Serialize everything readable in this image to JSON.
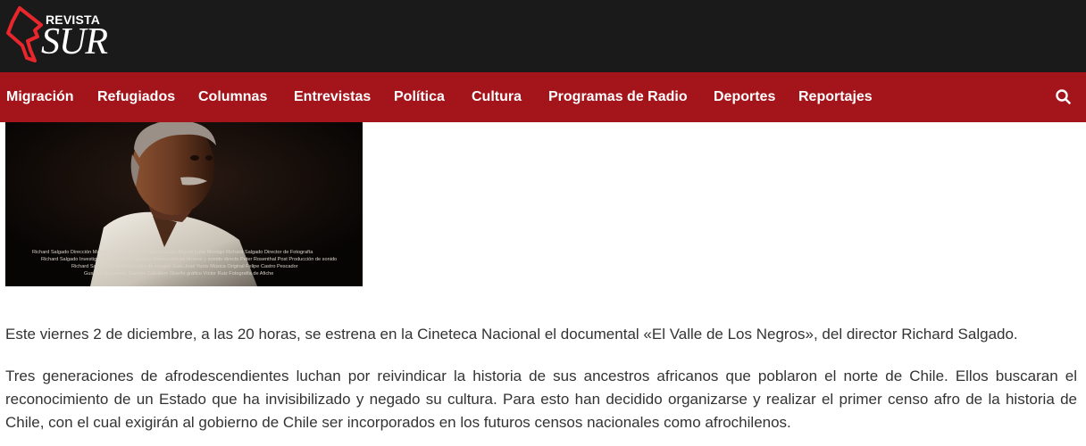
{
  "header": {
    "logo_small": "REVISTA",
    "logo_big": "SUR"
  },
  "nav": {
    "items": [
      {
        "label": "Migración"
      },
      {
        "label": "Refugiados"
      },
      {
        "label": "Columnas"
      },
      {
        "label": "Entrevistas"
      },
      {
        "label": "Política"
      },
      {
        "label": "Cultura"
      },
      {
        "label": "Programas de Radio"
      },
      {
        "label": "Deportes"
      },
      {
        "label": "Reportajes"
      }
    ],
    "search_icon": "search-icon"
  },
  "article": {
    "image_credits": [
      "Richard Salgado Dirección   Miguel Luna y Richard Salgado Guión   Miguel Luna Montaje   Richard Salgado Director de Fotografía",
      "Richard Salgado Investigación   Sebastián Salgado Producción en terreno y sonido directo   Peter Rosenthal Post Producción de sonido",
      "Richard Salgado Post Producción de imagen   Juan José Yunis Música Original   Felipe Castro Pescador",
      "Gustavo Navarrete, Daniela Caballero Diseño gráfico   Víctor Ruiz Fotografía de Afiche"
    ],
    "paragraphs": [
      "Este viernes 2 de diciembre, a las 20 horas, se estrena en la Cineteca Nacional el documental «El Valle de Los Negros», del director Richard Salgado.",
      "Tres generaciones de afrodescendientes luchan por reivindicar la historia de sus ancestros africanos que poblaron el norte de Chile. Ellos buscaran el reconocimiento de un Estado que ha invisibilizado y negado su cultura. Para esto han decidido organizarse y realizar el primer censo afro de la historia de Chile, con el cual exigirán al gobierno de Chile ser incorporados en los futuros censos nacionales como afrochilenos."
    ]
  },
  "colors": {
    "header_bg": "#1a1a1a",
    "nav_bg": "#a4141b",
    "logo_red": "#e8262c",
    "text": "#333333"
  }
}
